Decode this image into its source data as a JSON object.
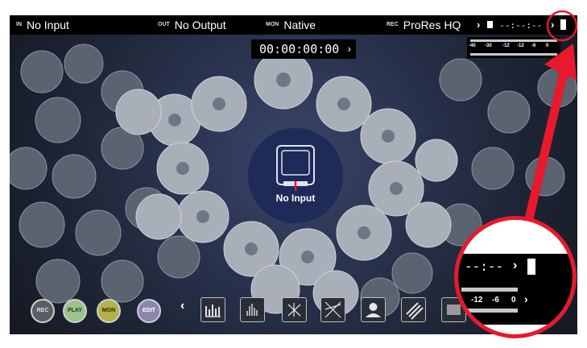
{
  "topbar": {
    "in_key": "IN",
    "in_value": "No Input",
    "out_key": "OUT",
    "out_value": "No Output",
    "mon_key": "MON",
    "mon_value": "Native",
    "rec_key": "REC",
    "rec_value": "ProRes HQ",
    "time_remaining": "--:--:--"
  },
  "timecode": "00:00:00:00",
  "meter_ticks": [
    "-40",
    "-30",
    "-12",
    "-12",
    "-6",
    "0"
  ],
  "center": {
    "status": "No Input"
  },
  "buttons": {
    "rec": "REC",
    "play": "PLAY",
    "mon": "MON",
    "edit": "EDIT"
  },
  "callout": {
    "time_remaining": "--:--",
    "ticks": [
      "-12",
      "-6",
      "0"
    ]
  },
  "colors": {
    "accent_red": "#e8192c",
    "rec_button": "#5a5d64",
    "play_button": "#9bc48a",
    "mon_button": "#b4b14a",
    "edit_button": "#8a86ad",
    "center_badge": "#1e2a58"
  }
}
